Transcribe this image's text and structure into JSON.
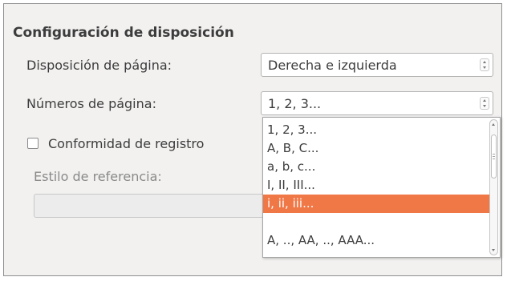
{
  "section": {
    "title": "Configuración de disposición"
  },
  "page_layout": {
    "label": "Disposición de página:",
    "value": "Derecha e izquierda"
  },
  "page_numbers": {
    "label": "Números de página:",
    "value": "1, 2, 3...",
    "options": [
      "1, 2, 3...",
      "A, B, C...",
      "a, b, c...",
      "I, II, III...",
      "i, ii, iii...",
      "A, .., AA, .., AAA..."
    ],
    "selected_index": 4
  },
  "register_true": {
    "label": "Conformidad de registro",
    "checked": false
  },
  "reference_style": {
    "label": "Estilo de referencia:",
    "value": ""
  },
  "colors": {
    "highlight": "#f07746",
    "panel_bg": "#f2f1f0"
  }
}
